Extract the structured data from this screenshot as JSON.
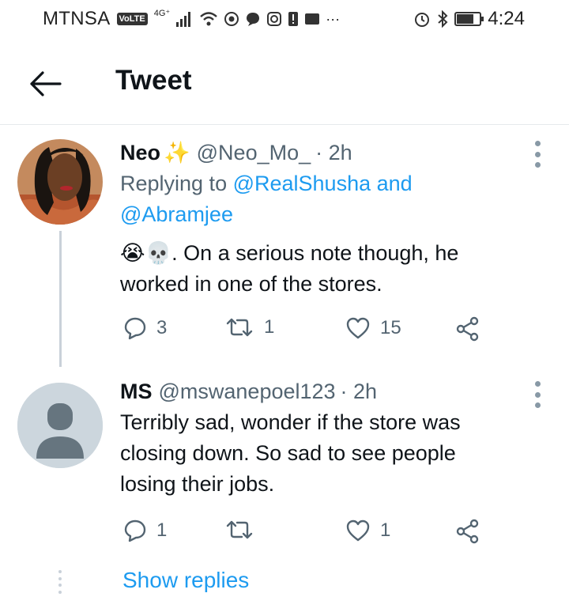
{
  "status_bar": {
    "carrier": "MTNSA",
    "volte_badge": "VoLTE",
    "network": "4G⁺",
    "time": "4:24",
    "battery_level": 0.75
  },
  "header": {
    "title": "Tweet"
  },
  "tweets": [
    {
      "name": "Neo",
      "name_emoji": "✨",
      "handle": "@Neo_Mo_",
      "time": "· 2h",
      "replying_prefix": "Replying to ",
      "mention_1": "@RealShusha",
      "replying_and": " and",
      "mention_2": "@Abramjee",
      "emojis": "😭💀",
      "text": ". On a serious note though, he worked in one of the stores.",
      "replies": "3",
      "retweets": "1",
      "likes": "15"
    },
    {
      "name": "MS",
      "handle": "@mswanepoel123",
      "time": "· 2h",
      "text": "Terribly sad, wonder if the store was closing down. So sad to see people losing their jobs.",
      "replies": "1",
      "retweets": "",
      "likes": "1"
    }
  ],
  "show_replies": "Show replies",
  "icons": {
    "back": "arrow-left-icon",
    "reply": "reply-icon",
    "retweet": "retweet-icon",
    "like": "heart-icon",
    "share": "share-icon",
    "more": "more-icon"
  },
  "colors": {
    "link": "#1d9bf0",
    "secondary_text": "#536471",
    "primary_text": "#0f1419"
  }
}
